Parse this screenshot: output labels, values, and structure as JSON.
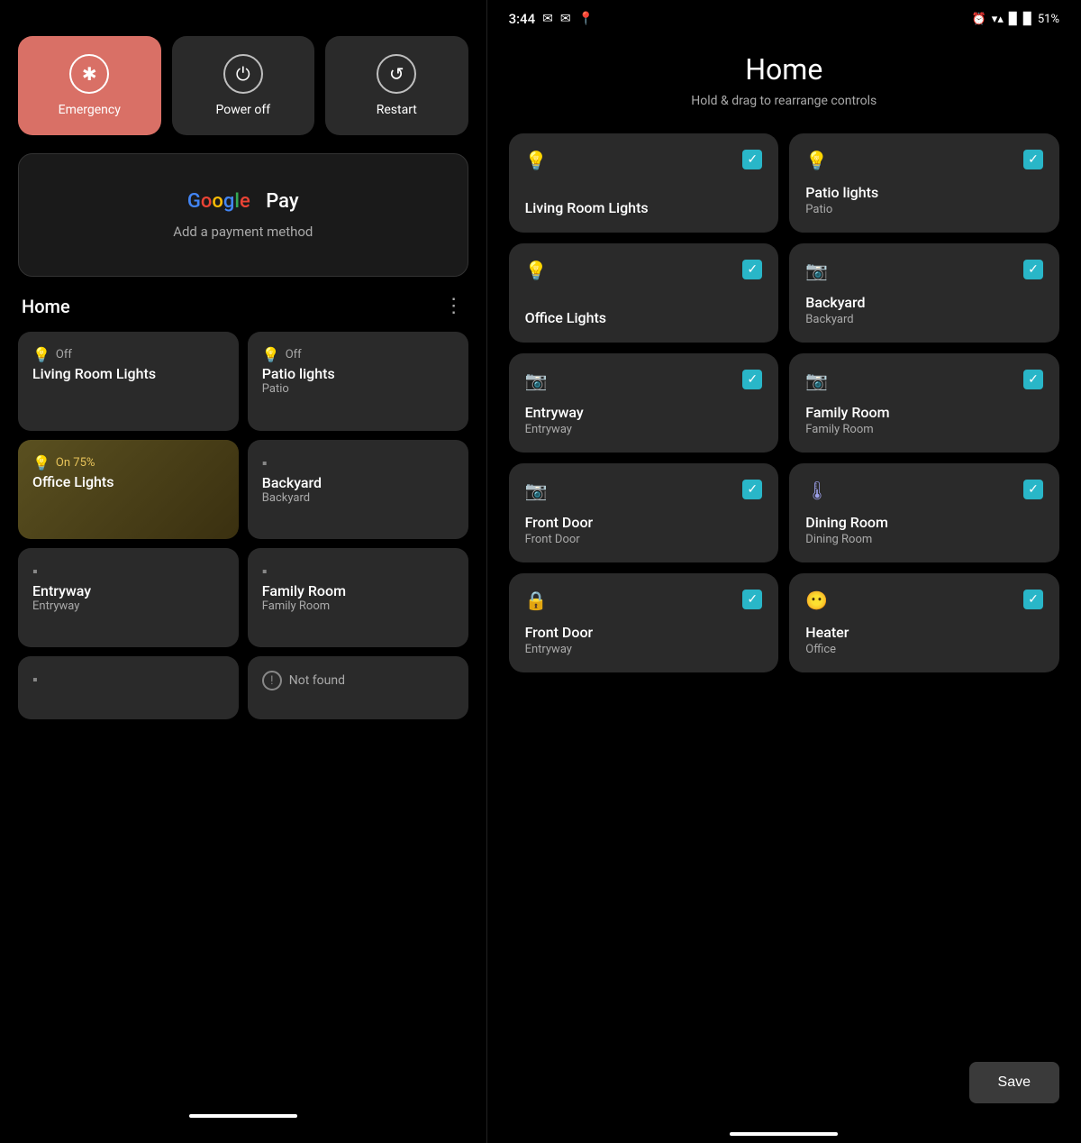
{
  "left": {
    "power_buttons": [
      {
        "id": "emergency",
        "label": "Emergency",
        "icon": "✱",
        "style": "emergency"
      },
      {
        "id": "power_off",
        "label": "Power off",
        "icon": "⏻",
        "style": "normal"
      },
      {
        "id": "restart",
        "label": "Restart",
        "icon": "↺",
        "style": "normal"
      }
    ],
    "gpay": {
      "logo_g": "G",
      "logo_pay": "Pay",
      "subtitle": "Add a payment method"
    },
    "home": {
      "title": "Home",
      "menu_icon": "⋮",
      "devices": [
        {
          "id": "living-room-lights",
          "status": "Off",
          "name": "Living Room Lights",
          "sub": "",
          "state": "off",
          "icon": "💡"
        },
        {
          "id": "patio-lights",
          "status": "Off",
          "name": "Patio lights",
          "sub": "Patio",
          "state": "off",
          "icon": "💡"
        },
        {
          "id": "office-lights",
          "status": "On 75%",
          "name": "Office Lights",
          "sub": "",
          "state": "on",
          "icon": "💡"
        },
        {
          "id": "backyard",
          "status": "",
          "name": "Backyard",
          "sub": "Backyard",
          "state": "off",
          "icon": "📷"
        },
        {
          "id": "entryway",
          "status": "",
          "name": "Entryway",
          "sub": "Entryway",
          "state": "off",
          "icon": "📷"
        },
        {
          "id": "family-room",
          "status": "",
          "name": "Family Room",
          "sub": "Family Room",
          "state": "off",
          "icon": "📷"
        }
      ],
      "bottom_partial": [
        {
          "id": "partial-left",
          "icon": "📷",
          "label": ""
        },
        {
          "id": "partial-right",
          "status": "Not found",
          "icon": "⚠"
        }
      ]
    }
  },
  "right": {
    "status_bar": {
      "time": "3:44",
      "battery": "51%"
    },
    "title": "Home",
    "subtitle": "Hold & drag to rearrange controls",
    "devices": [
      {
        "id": "living-room-lights",
        "icon": "💡",
        "icon_type": "bulb",
        "name": "Living Room Lights",
        "sub": "",
        "checked": true
      },
      {
        "id": "patio-lights",
        "icon": "💡",
        "icon_type": "bulb",
        "name": "Patio lights",
        "sub": "Patio",
        "checked": true
      },
      {
        "id": "office-lights",
        "icon": "💡",
        "icon_type": "bulb",
        "name": "Office Lights",
        "sub": "",
        "checked": true
      },
      {
        "id": "backyard",
        "icon": "📷",
        "icon_type": "camera",
        "name": "Backyard",
        "sub": "Backyard",
        "checked": true
      },
      {
        "id": "entryway-cam",
        "icon": "📷",
        "icon_type": "camera",
        "name": "Entryway",
        "sub": "Entryway",
        "checked": true
      },
      {
        "id": "family-room-cam",
        "icon": "📷",
        "icon_type": "camera",
        "name": "Family Room",
        "sub": "Family Room",
        "checked": true
      },
      {
        "id": "front-door-cam",
        "icon": "📷",
        "icon_type": "camera",
        "name": "Front Door",
        "sub": "Front Door",
        "checked": true
      },
      {
        "id": "dining-room",
        "icon": "🌡",
        "icon_type": "therm",
        "name": "Dining Room",
        "sub": "Dining Room",
        "checked": true
      },
      {
        "id": "front-door-lock",
        "icon": "🔒",
        "icon_type": "lock",
        "name": "Front Door",
        "sub": "Entryway",
        "checked": true
      },
      {
        "id": "heater",
        "icon": "😶",
        "icon_type": "face",
        "name": "Heater",
        "sub": "Office",
        "checked": true
      }
    ],
    "save_label": "Save"
  }
}
